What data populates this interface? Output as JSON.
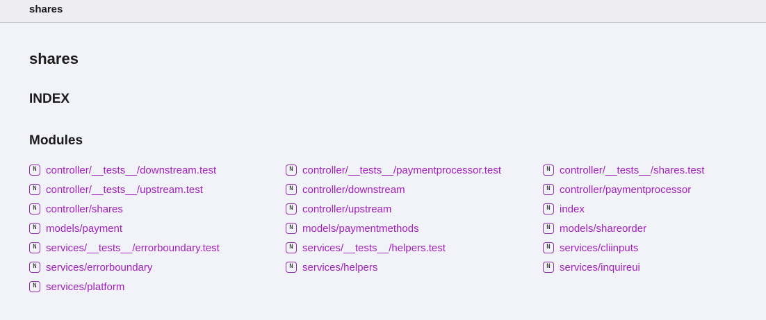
{
  "header": {
    "title": "shares"
  },
  "main": {
    "title": "shares",
    "index_heading": "INDEX",
    "modules_heading": "Modules",
    "module_icon_letter": "N",
    "modules": [
      "controller/__tests__/downstream.test",
      "controller/__tests__/paymentprocessor.test",
      "controller/__tests__/shares.test",
      "controller/__tests__/upstream.test",
      "controller/downstream",
      "controller/paymentprocessor",
      "controller/shares",
      "controller/upstream",
      "index",
      "models/payment",
      "models/paymentmethods",
      "models/shareorder",
      "services/__tests__/errorboundary.test",
      "services/__tests__/helpers.test",
      "services/cliinputs",
      "services/errorboundary",
      "services/helpers",
      "services/inquireui",
      "services/platform"
    ]
  },
  "colors": {
    "link": "#a11fbd",
    "icon_border": "#8e2dab",
    "background": "#f2f3f8",
    "topbar": "#eeeef2"
  }
}
